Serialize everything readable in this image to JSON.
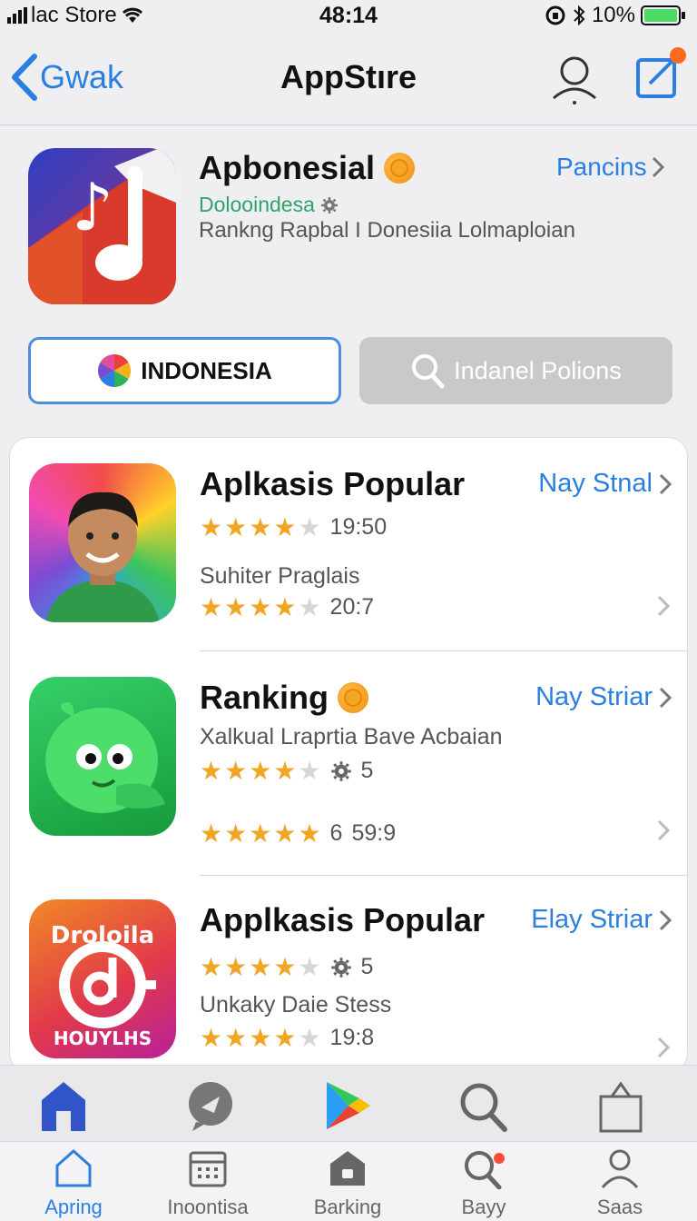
{
  "status": {
    "carrier": "lac Store",
    "time": "48:14",
    "battery": "10%"
  },
  "nav": {
    "back_label": "Gwak",
    "title": "AppStıre"
  },
  "hero": {
    "title": "Apbonesial",
    "subtitle": "Doloоindesa",
    "description": "Rankng Rapbal I Donesiia Lolmaploian",
    "link": "Pancins"
  },
  "buttons": {
    "indonesia": "INDONESIA",
    "search": "Indanel Polions"
  },
  "apps": [
    {
      "name": "Aplkasis Popular",
      "link": "Nay Stnal",
      "rating1": 4,
      "meta1": "19:50",
      "sub": "Suhiter Praglais",
      "rating2": 4,
      "meta2": "20:7"
    },
    {
      "name": "Ranking",
      "link": "Nay Striar",
      "sub": "Xalkual Lraprtia Bave Acbaian",
      "rating1": 4,
      "meta1": "5",
      "rating2": 5,
      "meta2a": "6",
      "meta2": "59:9"
    },
    {
      "name": "Applkasis Popular",
      "link": "Elay Striar",
      "rating1": 4,
      "meta1": "5",
      "sub": "Unkaky Daie Stess",
      "rating2": 4,
      "meta2": "19:8",
      "icon_text_top": "Droloila",
      "icon_text_bottom": "HOUYLHS"
    }
  ],
  "tabs": [
    {
      "label": "Apring"
    },
    {
      "label": "Inoontisa"
    },
    {
      "label": "Barking"
    },
    {
      "label": "Bayy"
    },
    {
      "label": "Saas"
    }
  ],
  "colors": {
    "accent": "#2a7fe0",
    "star": "#f2a423",
    "notify": "#ff6a1f"
  }
}
